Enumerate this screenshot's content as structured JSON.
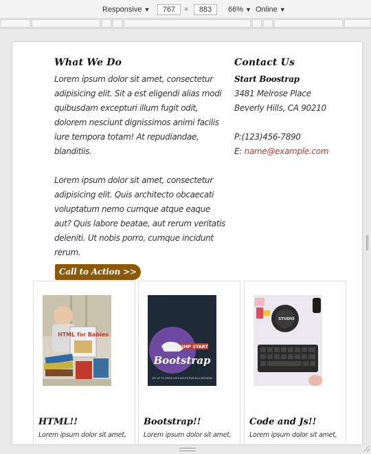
{
  "toolbar": {
    "device": "Responsive",
    "width": "767",
    "height": "883",
    "zoom": "66%",
    "network": "Online"
  },
  "about": {
    "heading": "What We Do",
    "paragraph1": "Lorem ipsum dolor sit amet, consectetur adipisicing elit. Sit a est eligendi alias modi quibusdam excepturi illum fugit odit, dolorem nesciunt dignissimos animi facilis iure tempora totam! At repudiandae, blanditiis.",
    "paragraph2": "Lorem ipsum dolor sit amet, consectetur adipisicing elit. Quis architecto obcaecati voluptatum nemo cumque atque eaque aut? Quis labore beatae, aut rerum veritatis deleniti. Ut nobis porro, cumque incidunt rerum.",
    "cta_label": "Call to Action >>"
  },
  "contact": {
    "heading": "Contact Us",
    "name": "Start Boostrap",
    "address1": "3481 Melrose Place",
    "address2": "Beverly Hills, CA 90210",
    "phone": "P:(123)456-7890",
    "email_prefix": "E:",
    "email": "name@example.com"
  },
  "cards": [
    {
      "title": "HTML!!",
      "text": "Lorem ipsum dolor sit amet,"
    },
    {
      "title": "Bootstrap!!",
      "text": "Lorem ipsum dolor sit amet,"
    },
    {
      "title": "Code and Js!!",
      "text": "Lorem ipsum dolor sit amet,"
    }
  ],
  "book": {
    "html_cover": "HTML for Babies",
    "bootstrap_banner": "JUMP START",
    "bootstrap_title": "Bootstrap",
    "bootstrap_sub": "GET UP TO SPEED WITH BOOTSTRAP IN A WEEKEND",
    "studio_label": "STUDIO"
  },
  "colors": {
    "cta": "#8a5a09",
    "link": "#c0392b"
  }
}
